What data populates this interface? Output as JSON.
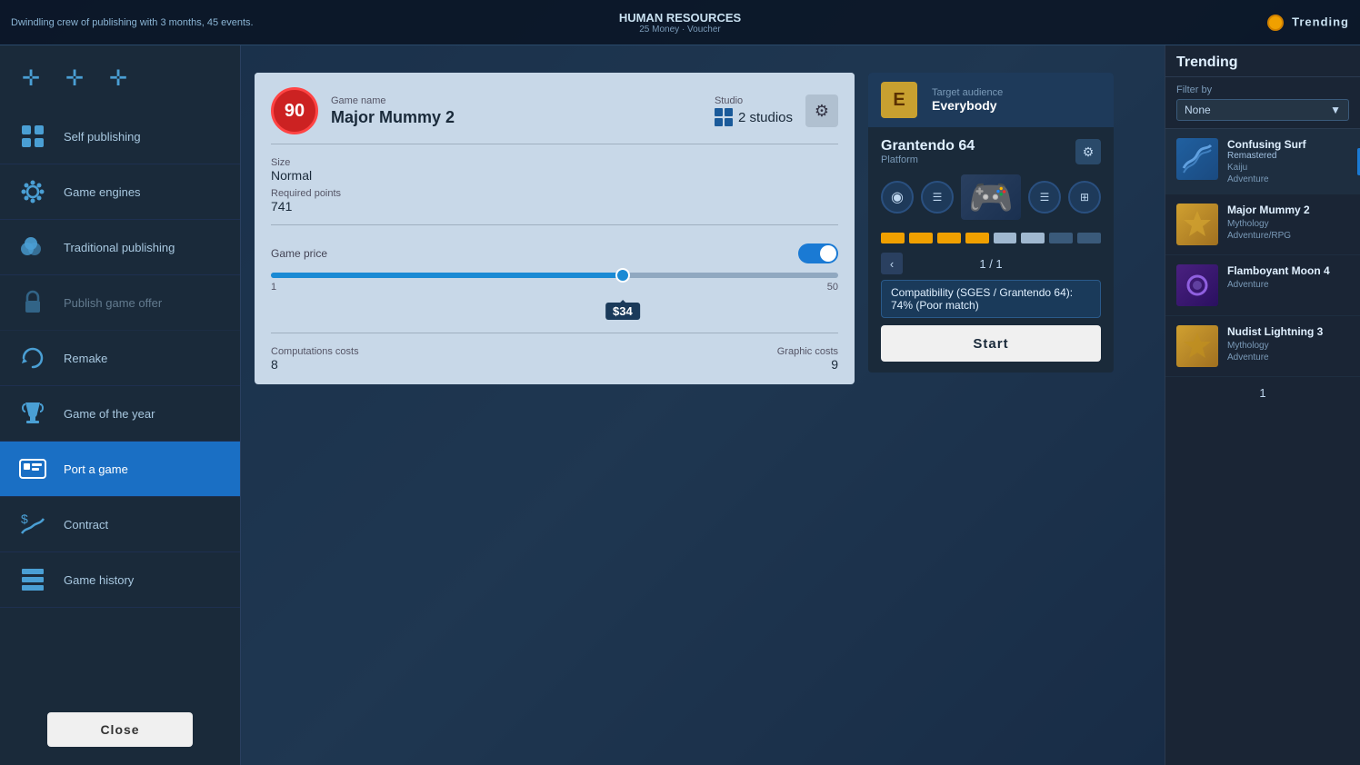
{
  "topBar": {
    "infoText": "Dwindling crew of publishing with 3 months, 45 events.",
    "title": "HUMAN RESOURCES",
    "subtitle": "25 Money · Voucher",
    "rightLabel": "Trending"
  },
  "sidebar": {
    "topIcons": [
      "+",
      "+",
      "+"
    ],
    "items": [
      {
        "id": "self-publishing",
        "label": "Self publishing",
        "icon": "plus",
        "locked": false,
        "active": false
      },
      {
        "id": "game-engines",
        "label": "Game engines",
        "icon": "gear",
        "locked": false,
        "active": false
      },
      {
        "id": "traditional-publishing",
        "label": "Traditional publishing",
        "icon": "coins",
        "locked": false,
        "active": false
      },
      {
        "id": "publish-game-offer",
        "label": "Publish game offer",
        "icon": "lock",
        "locked": true,
        "active": false
      },
      {
        "id": "remake",
        "label": "Remake",
        "icon": "redo",
        "locked": false,
        "active": false
      },
      {
        "id": "game-of-the-year",
        "label": "Game of the year",
        "icon": "trophy",
        "locked": false,
        "active": false
      },
      {
        "id": "port-a-game",
        "label": "Port a game",
        "icon": "port",
        "locked": false,
        "active": true
      },
      {
        "id": "contract",
        "label": "Contract",
        "icon": "dollar",
        "locked": false,
        "active": false
      },
      {
        "id": "game-history",
        "label": "Game history",
        "icon": "history",
        "locked": false,
        "active": false
      }
    ],
    "closeButton": "Close"
  },
  "portDialog": {
    "gameScore": "90",
    "gameNameLabel": "Game name",
    "gameName": "Major Mummy 2",
    "studioLabel": "Studio",
    "studioName": "2 studios",
    "sizeLabel": "Size",
    "sizeValue": "Normal",
    "requiredPointsLabel": "Required points",
    "requiredPointsValue": "741",
    "gamePriceLabel": "Game price",
    "priceMin": "1",
    "priceMax": "50",
    "priceValue": "$34",
    "computationCostsLabel": "Computations costs",
    "computationCostsValue": "8",
    "graphicCostsLabel": "Graphic costs",
    "graphicCostsValue": "9"
  },
  "platformPanel": {
    "targetAudienceLabel": "Target audience",
    "targetAudienceValue": "Everybody",
    "platformName": "Grantendo 64",
    "platformSub": "Platform",
    "paginationCurrent": "1",
    "paginationTotal": "1",
    "compatibilityText": "Compatibility (SGES / Grantendo 64):",
    "compatibilityValue": "74% (Poor match)",
    "startButton": "Start"
  },
  "trending": {
    "title": "Trending",
    "filterLabel": "Filter by",
    "filterValue": "None",
    "items": [
      {
        "name": "Confusing Surf",
        "subtitle": "Remastered",
        "genre": "Kaiju",
        "type": "Adventure",
        "thumbStyle": "blue",
        "selected": true
      },
      {
        "name": "Major Mummy 2",
        "subtitle": "",
        "genre": "Mythology",
        "type": "Adventure/RPG",
        "thumbStyle": "gold",
        "selected": false
      },
      {
        "name": "Flamboyant Moon 4",
        "subtitle": "",
        "genre": "",
        "type": "Adventure",
        "thumbStyle": "blue",
        "selected": false
      },
      {
        "name": "Nudist Lightning 3",
        "subtitle": "",
        "genre": "Mythology",
        "type": "Adventure",
        "thumbStyle": "gold",
        "selected": false
      }
    ],
    "pageNumber": "1"
  }
}
